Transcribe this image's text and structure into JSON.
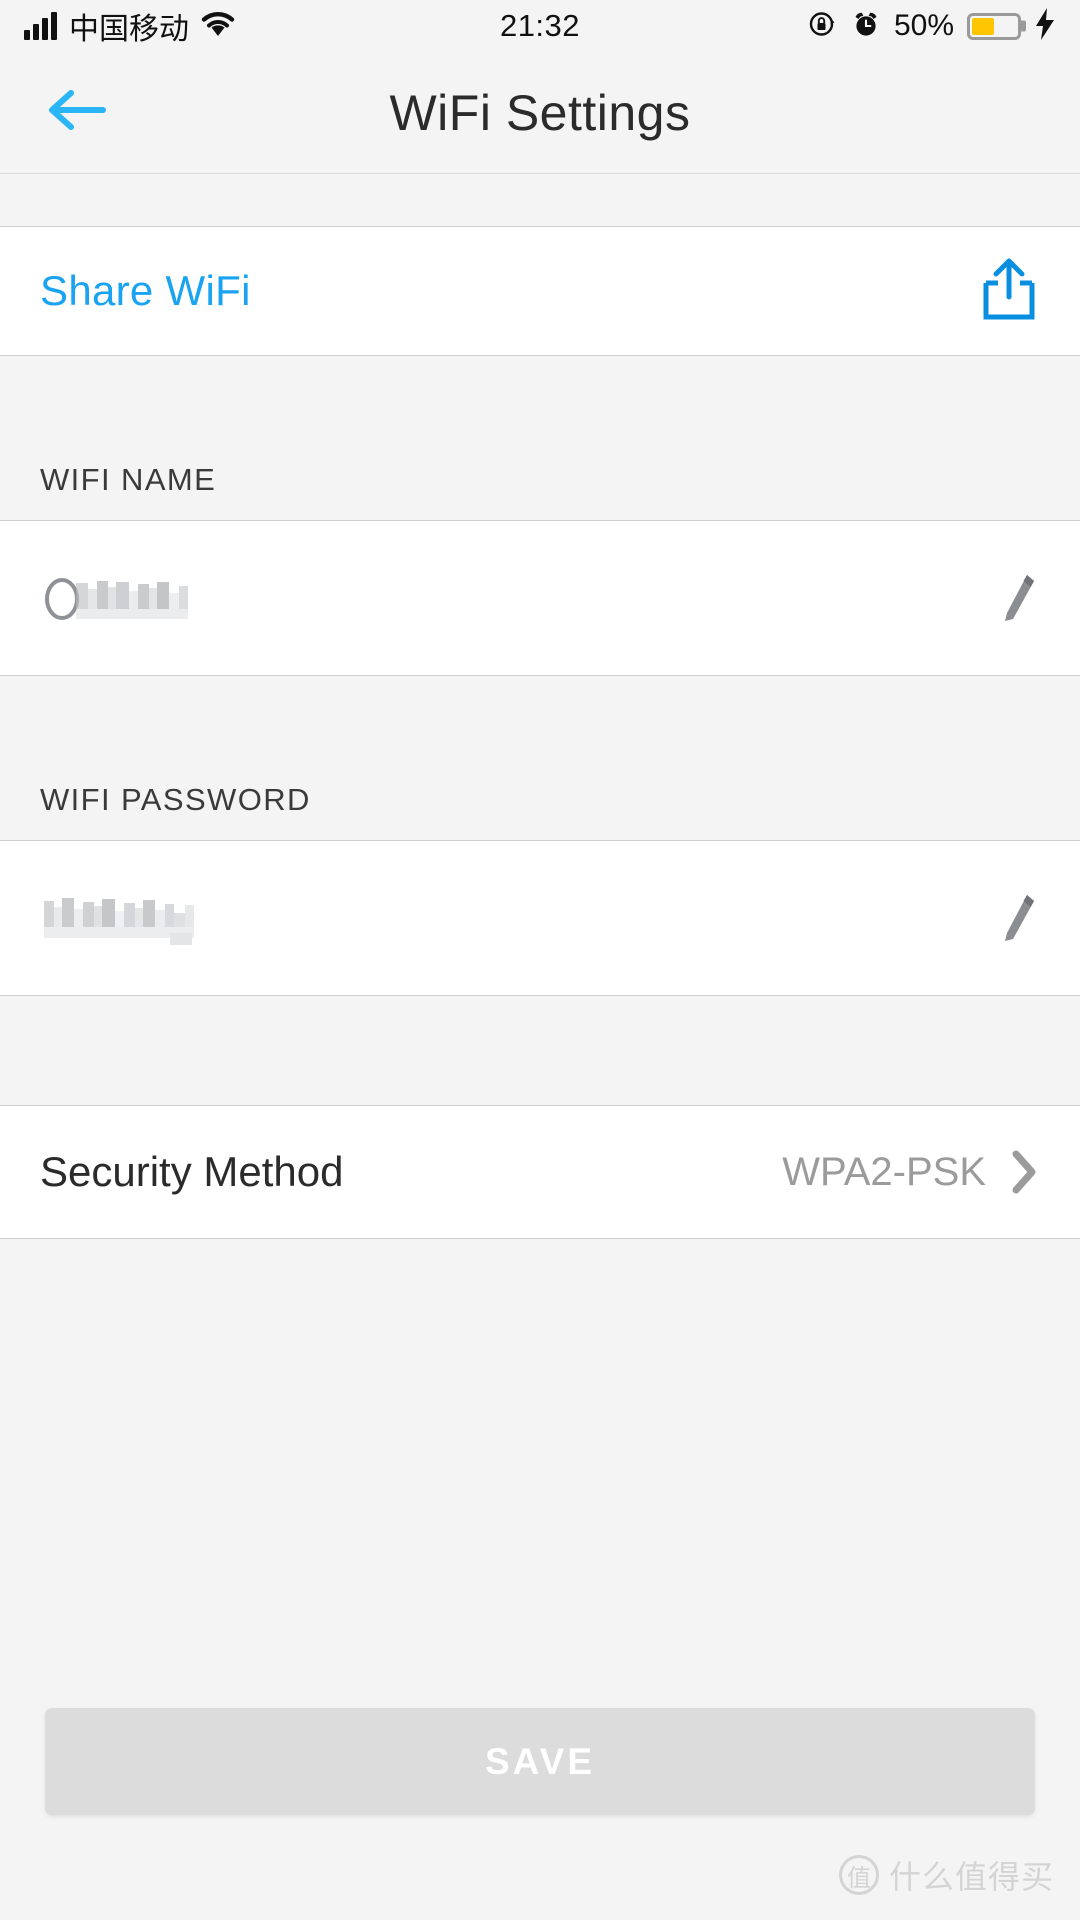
{
  "status_bar": {
    "carrier": "中国移动",
    "time": "21:32",
    "battery_percent": "50%",
    "signal_icon": "signal-bars-icon",
    "wifi_icon": "wifi-icon",
    "rotation_lock_icon": "rotation-lock-icon",
    "alarm_icon": "alarm-clock-icon",
    "battery_icon": "battery-icon",
    "charging_icon": "charging-bolt-icon",
    "battery_level": 50,
    "battery_fill_color": "#ffc600"
  },
  "nav": {
    "title": "WiFi Settings",
    "back_icon": "back-arrow-icon",
    "accent_color": "#1aa3f0"
  },
  "share": {
    "label": "Share WiFi",
    "icon": "share-icon",
    "color": "#1aa3f0"
  },
  "wifi_name": {
    "section_label": "WIFI NAME",
    "value": "O████T",
    "value_censored": true,
    "edit_icon": "pencil-edit-icon"
  },
  "wifi_password": {
    "section_label": "WIFI PASSWORD",
    "value": "████████",
    "value_censored": true,
    "edit_icon": "pencil-edit-icon"
  },
  "security": {
    "label": "Security Method",
    "value": "WPA2-PSK",
    "chevron_icon": "chevron-right-icon"
  },
  "save": {
    "label": "SAVE",
    "enabled": false,
    "background": "#dcdcdc"
  },
  "watermark": {
    "logo_char": "值",
    "text": "什么值得买"
  }
}
